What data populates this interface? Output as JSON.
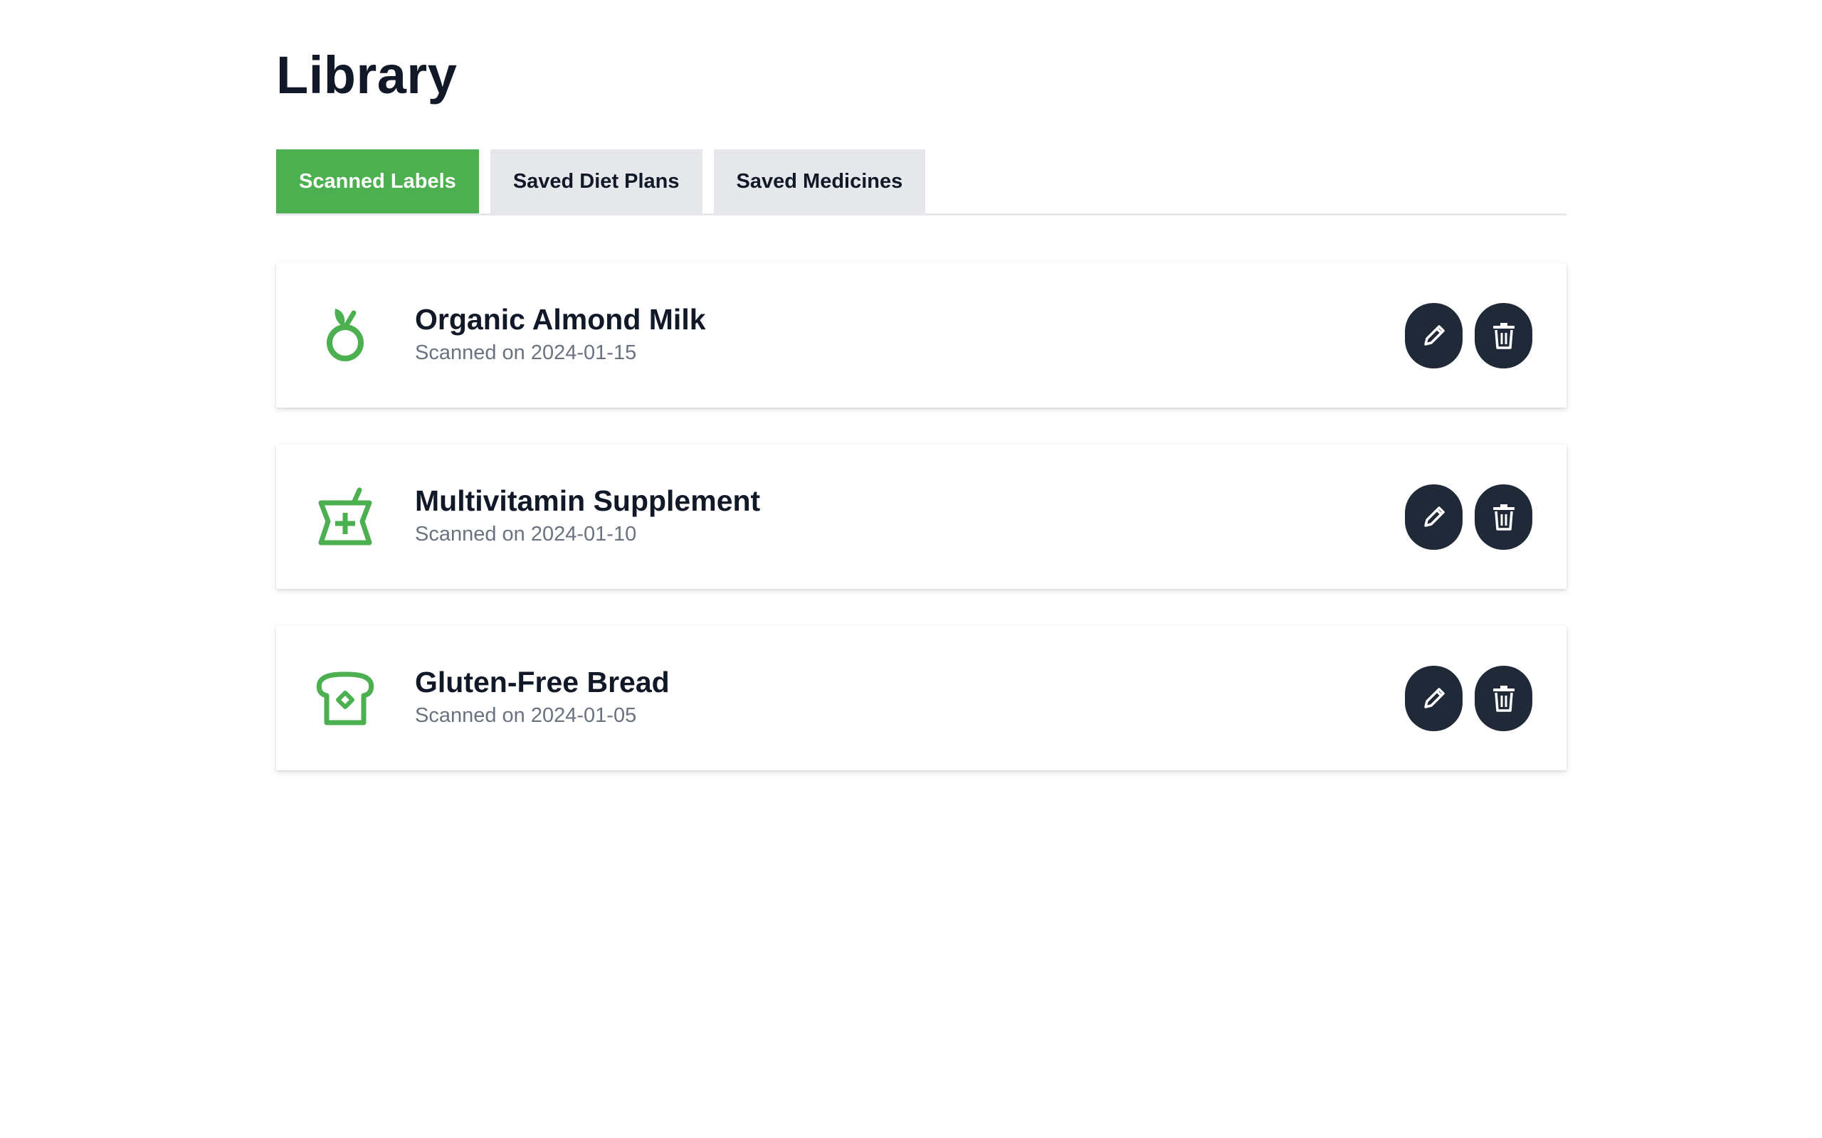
{
  "page": {
    "title": "Library"
  },
  "tabs": [
    {
      "label": "Scanned Labels",
      "active": true
    },
    {
      "label": "Saved Diet Plans",
      "active": false
    },
    {
      "label": "Saved Medicines",
      "active": false
    }
  ],
  "items": [
    {
      "title": "Organic Almond Milk",
      "subtitle": "Scanned on 2024-01-15",
      "icon": "apple-icon"
    },
    {
      "title": "Multivitamin Supplement",
      "subtitle": "Scanned on 2024-01-10",
      "icon": "mortar-pestle-icon"
    },
    {
      "title": "Gluten-Free Bread",
      "subtitle": "Scanned on 2024-01-05",
      "icon": "bread-icon"
    }
  ],
  "actions": {
    "edit_icon": "pencil-icon",
    "delete_icon": "trash-icon"
  },
  "colors": {
    "accent": "#4caf50",
    "action_button": "#1f2937",
    "tab_inactive": "#e5e7eb",
    "text_primary": "#111827",
    "text_secondary": "#6b7280"
  }
}
